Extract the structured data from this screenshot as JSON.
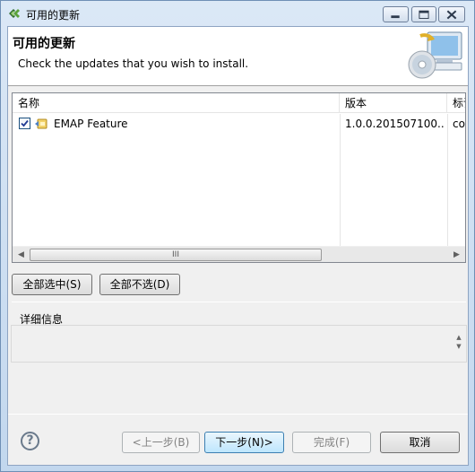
{
  "window": {
    "title": "可用的更新",
    "icon": "eclipse-update-icon"
  },
  "banner": {
    "title": "可用的更新",
    "description": "Check the updates that you wish to install.",
    "image": "computer-cd-update-icon"
  },
  "table": {
    "columns": [
      "名称",
      "版本",
      "标识"
    ],
    "column_display": [
      "名称",
      "版本",
      "标识"
    ],
    "rows": [
      {
        "checked": true,
        "name": "EMAP Feature",
        "version": "1.0.0.201507100...",
        "id": "cor"
      }
    ],
    "scrollbar_grip": "III"
  },
  "buttons": {
    "select_all": "全部选中(S)",
    "deselect_all": "全部不选(D)",
    "back": "<上一步(B)",
    "next": "下一步(N)>",
    "finish": "完成(F)",
    "cancel": "取消"
  },
  "details": {
    "label": "详细信息",
    "content": ""
  },
  "help": {
    "glyph": "?"
  },
  "colors": {
    "frame": "#c2d7ee",
    "default_button": "#bee6fd",
    "disabled_text": "#838383"
  }
}
